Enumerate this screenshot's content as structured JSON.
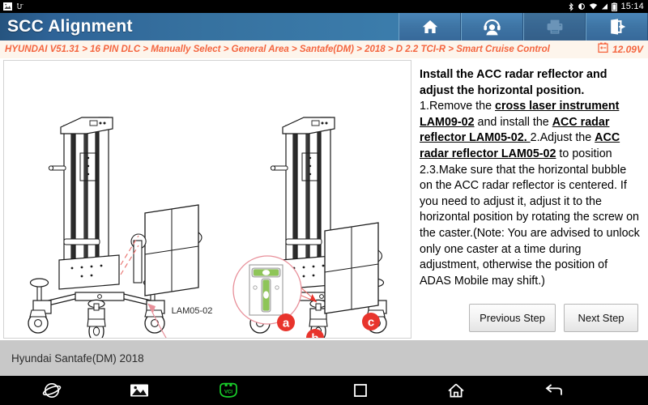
{
  "statusbar": {
    "clock": "15:14",
    "icons": [
      "screenshot-icon",
      "usb-icon",
      "bluetooth-icon",
      "brightness-icon",
      "wifi-icon",
      "signal-icon",
      "battery-icon"
    ]
  },
  "header": {
    "title": "SCC Alignment",
    "buttons": [
      {
        "name": "home-button",
        "icon": "home-icon",
        "enabled": true
      },
      {
        "name": "support-button",
        "icon": "headset-icon",
        "enabled": true
      },
      {
        "name": "print-button",
        "icon": "printer-icon",
        "enabled": false
      },
      {
        "name": "exit-button",
        "icon": "exit-icon",
        "enabled": true
      }
    ]
  },
  "breadcrumb": {
    "path": "HYUNDAI V51.31 > 16 PIN DLC > Manually Select > General Area > Santafe(DM) > 2018 > D 2.2 TCI-R > Smart Cruise Control",
    "voltage": "12.09V",
    "battery_icon": "battery-voltage-icon"
  },
  "diagram": {
    "left_callout_label": "LAM05-02",
    "markers": [
      "a",
      "b",
      "c"
    ],
    "bubble_level_label": "horizontal-bubble-level",
    "accent_red": "#e8342c",
    "callout_pink": "#e8909a"
  },
  "instructions": {
    "heading": "Install the ACC radar reflector and adjust the horizontal position.",
    "steps": [
      {
        "number": "1.",
        "segments": [
          {
            "text": "Remove the ",
            "style": "normal"
          },
          {
            "text": "cross laser instrument LAM09-02",
            "style": "underline"
          },
          {
            "text": " and install the ",
            "style": "normal"
          },
          {
            "text": "ACC radar reflector LAM05-02. ",
            "style": "underline"
          }
        ]
      },
      {
        "number": "2.",
        "segments": [
          {
            "text": "Adjust the ",
            "style": "normal"
          },
          {
            "text": "ACC radar reflector LAM05-02",
            "style": "underline"
          },
          {
            "text": " to position 2.",
            "style": "normal"
          }
        ]
      },
      {
        "number": "3.",
        "segments": [
          {
            "text": "Make sure that the horizontal bubble on the ACC radar reflector is centered. If you need to adjust it, adjust it to the horizontal position by rotating the screw on the caster.(Note: You are advised to unlock only one caster at a time during adjustment, otherwise the position of ADAS Mobile may shift.)",
            "style": "normal"
          }
        ]
      }
    ],
    "previous_label": "Previous Step",
    "next_label": "Next Step"
  },
  "footer": {
    "vehicle": "Hyundai Santafe(DM) 2018"
  },
  "navbar": {
    "items": [
      {
        "name": "browser-icon"
      },
      {
        "name": "gallery-icon"
      },
      {
        "name": "vci-icon",
        "label": "VCI",
        "color": "#19cc2a"
      },
      {
        "name": "recent-apps-icon"
      },
      {
        "name": "home-nav-icon"
      },
      {
        "name": "back-nav-icon"
      }
    ]
  }
}
